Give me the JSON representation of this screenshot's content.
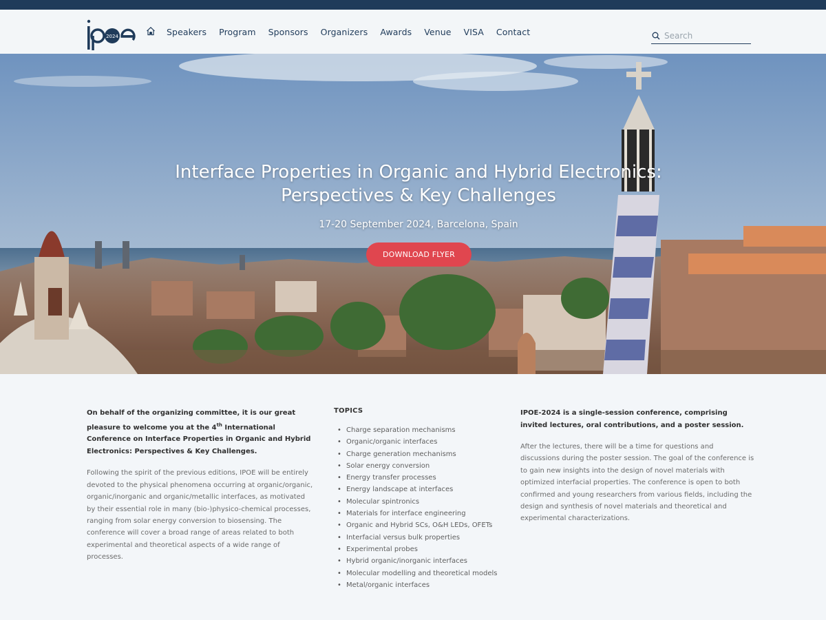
{
  "logo": {
    "text": "ipoe",
    "year": "2024"
  },
  "nav": {
    "home_icon": "home-icon",
    "items": [
      "Speakers",
      "Program",
      "Sponsors",
      "Organizers",
      "Awards",
      "Venue",
      "VISA",
      "Contact"
    ]
  },
  "search": {
    "placeholder": "Search",
    "icon": "search-icon"
  },
  "hero": {
    "title_line1": "Interface Properties in Organic and Hybrid Electronics:",
    "title_line2": "Perspectives & Key Challenges",
    "subtitle": "17-20 September 2024, Barcelona, Spain",
    "button": "DOWNLOAD FLYER"
  },
  "intro": {
    "lead_part1": "On behalf of the organizing committee, it is our great pleasure to welcome you at the 4",
    "lead_sup": "th",
    "lead_part2": " International Conference on Interface Properties in Organic and Hybrid Electronics: Perspectives & Key Challenges.",
    "body": "Following the spirit of the previous editions, IPOE will be entirely devoted to the physical phenomena occurring at organic/organic, organic/inorganic and organic/metallic interfaces, as motivated by their essential role in many (bio-)physico-chemical processes, ranging from solar energy conversion to biosensing. The conference will cover a broad range of areas related to both experimental and theoretical aspects of a wide range of processes."
  },
  "topics": {
    "title": "TOPICS",
    "items": [
      "Charge separation mechanisms",
      "Organic/organic interfaces",
      "Charge generation mechanisms",
      "Solar energy conversion",
      "Energy transfer processes",
      "Energy landscape at interfaces",
      "Molecular spintronics",
      "Materials for interface engineering",
      "Organic and Hybrid SCs, O&H LEDs, OFETs",
      "Interfacial versus bulk properties",
      "Experimental probes",
      "Hybrid organic/inorganic interfaces",
      "Molecular modelling and theoretical models",
      "Metal/organic interfaces"
    ]
  },
  "about": {
    "lead": "IPOE-2024 is a single-session conference, comprising invited lectures, oral contributions, and a poster session.",
    "body": "After the lectures, there will be a time for questions and discussions during the poster session. The goal of the conference is to gain new insights into the design of novel materials with optimized interfacial properties. The conference is open to both confirmed and young researchers from various fields, including the design and synthesis of novel materials and theoretical and experimental characterizations."
  },
  "colors": {
    "navy": "#1f3b5a",
    "accent": "#e0464f",
    "background": "#f3f6f9"
  }
}
